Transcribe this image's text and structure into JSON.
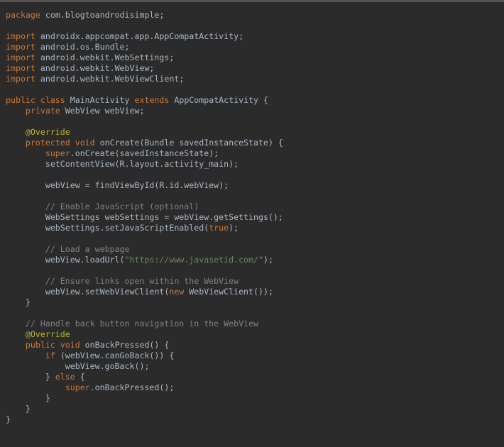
{
  "editor": {
    "colors": {
      "background": "#2b2b2b",
      "plain": "#a9b7c6",
      "keyword": "#cc7832",
      "annotation": "#bbb529",
      "comment": "#808080",
      "string": "#6a8759"
    },
    "lines": [
      [
        {
          "t": "kw",
          "v": "package"
        },
        {
          "t": "pl",
          "v": " com.blogtoandrodisimple;"
        }
      ],
      [],
      [
        {
          "t": "kw",
          "v": "import"
        },
        {
          "t": "pl",
          "v": " androidx.appcompat.app.AppCompatActivity;"
        }
      ],
      [
        {
          "t": "kw",
          "v": "import"
        },
        {
          "t": "pl",
          "v": " android.os.Bundle;"
        }
      ],
      [
        {
          "t": "kw",
          "v": "import"
        },
        {
          "t": "pl",
          "v": " android.webkit.WebSettings;"
        }
      ],
      [
        {
          "t": "kw",
          "v": "import"
        },
        {
          "t": "pl",
          "v": " android.webkit.WebView;"
        }
      ],
      [
        {
          "t": "kw",
          "v": "import"
        },
        {
          "t": "pl",
          "v": " android.webkit.WebViewClient;"
        }
      ],
      [],
      [
        {
          "t": "kw",
          "v": "public class"
        },
        {
          "t": "pl",
          "v": " MainActivity "
        },
        {
          "t": "kw",
          "v": "extends"
        },
        {
          "t": "pl",
          "v": " AppCompatActivity {"
        }
      ],
      [
        {
          "t": "pl",
          "v": "    "
        },
        {
          "t": "kw",
          "v": "private"
        },
        {
          "t": "pl",
          "v": " WebView webView;"
        }
      ],
      [],
      [
        {
          "t": "pl",
          "v": "    "
        },
        {
          "t": "ann",
          "v": "@Override"
        }
      ],
      [
        {
          "t": "pl",
          "v": "    "
        },
        {
          "t": "kw",
          "v": "protected void"
        },
        {
          "t": "pl",
          "v": " onCreate(Bundle savedInstanceState) {"
        }
      ],
      [
        {
          "t": "pl",
          "v": "        "
        },
        {
          "t": "kw",
          "v": "super"
        },
        {
          "t": "pl",
          "v": ".onCreate(savedInstanceState);"
        }
      ],
      [
        {
          "t": "pl",
          "v": "        setContentView(R.layout.activity_main);"
        }
      ],
      [],
      [
        {
          "t": "pl",
          "v": "        webView = findViewById(R.id.webView);"
        }
      ],
      [],
      [
        {
          "t": "pl",
          "v": "        "
        },
        {
          "t": "cm",
          "v": "// Enable JavaScript (optional)"
        }
      ],
      [
        {
          "t": "pl",
          "v": "        WebSettings webSettings = webView.getSettings();"
        }
      ],
      [
        {
          "t": "pl",
          "v": "        webSettings.setJavaScriptEnabled("
        },
        {
          "t": "kw",
          "v": "true"
        },
        {
          "t": "pl",
          "v": ");"
        }
      ],
      [],
      [
        {
          "t": "pl",
          "v": "        "
        },
        {
          "t": "cm",
          "v": "// Load a webpage"
        }
      ],
      [
        {
          "t": "pl",
          "v": "        webView.loadUrl("
        },
        {
          "t": "st",
          "v": "\"https://www.javasetid.com/\""
        },
        {
          "t": "pl",
          "v": ");"
        }
      ],
      [],
      [
        {
          "t": "pl",
          "v": "        "
        },
        {
          "t": "cm",
          "v": "// Ensure links open within the WebView"
        }
      ],
      [
        {
          "t": "pl",
          "v": "        webView.setWebViewClient("
        },
        {
          "t": "kw",
          "v": "new"
        },
        {
          "t": "pl",
          "v": " WebViewClient());"
        }
      ],
      [
        {
          "t": "pl",
          "v": "    }"
        }
      ],
      [],
      [
        {
          "t": "pl",
          "v": "    "
        },
        {
          "t": "cm",
          "v": "// Handle back button navigation in the WebView"
        }
      ],
      [
        {
          "t": "pl",
          "v": "    "
        },
        {
          "t": "ann",
          "v": "@Override"
        }
      ],
      [
        {
          "t": "pl",
          "v": "    "
        },
        {
          "t": "kw",
          "v": "public void"
        },
        {
          "t": "pl",
          "v": " onBackPressed() {"
        }
      ],
      [
        {
          "t": "pl",
          "v": "        "
        },
        {
          "t": "kw",
          "v": "if"
        },
        {
          "t": "pl",
          "v": " (webView.canGoBack()) {"
        }
      ],
      [
        {
          "t": "pl",
          "v": "            webView.goBack();"
        }
      ],
      [
        {
          "t": "pl",
          "v": "        } "
        },
        {
          "t": "kw",
          "v": "else"
        },
        {
          "t": "pl",
          "v": " {"
        }
      ],
      [
        {
          "t": "pl",
          "v": "            "
        },
        {
          "t": "kw",
          "v": "super"
        },
        {
          "t": "pl",
          "v": ".onBackPressed();"
        }
      ],
      [
        {
          "t": "pl",
          "v": "        }"
        }
      ],
      [
        {
          "t": "pl",
          "v": "    }"
        }
      ],
      [
        {
          "t": "pl",
          "v": "}"
        }
      ]
    ]
  }
}
